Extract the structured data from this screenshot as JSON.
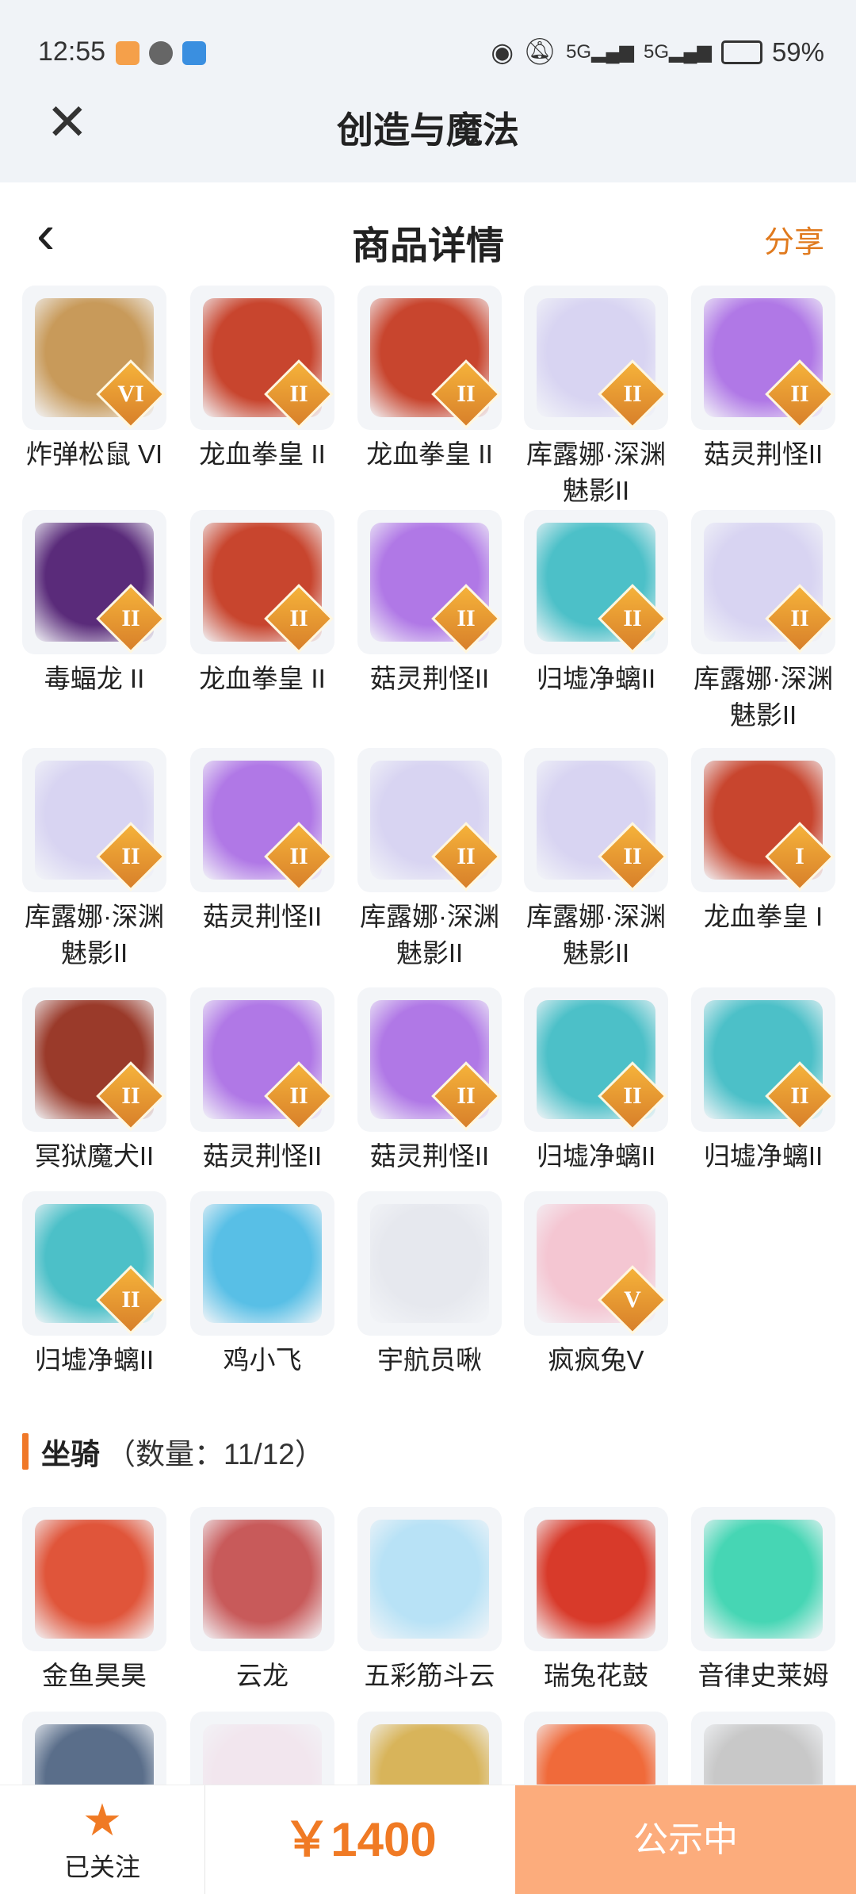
{
  "status_bar": {
    "time": "12:55",
    "battery": "59%",
    "icons": [
      "eye-icon",
      "bell-muted-icon",
      "signal-5g-icon",
      "signal-5g-icon",
      "battery-icon"
    ]
  },
  "app_bar": {
    "title": "创造与魔法",
    "close_icon": "close-icon"
  },
  "header": {
    "title": "商品详情",
    "share": "分享",
    "back_icon": "chevron-left-icon"
  },
  "pets": [
    {
      "name": "炸弹松鼠 VI",
      "badge": "VI",
      "color": "#c89a5a"
    },
    {
      "name": "龙血拳皇 II",
      "badge": "II",
      "color": "#c8452e"
    },
    {
      "name": "龙血拳皇 II",
      "badge": "II",
      "color": "#c8452e"
    },
    {
      "name": "库露娜·深渊魅影II",
      "badge": "II",
      "color": "#d8d4f2"
    },
    {
      "name": "菇灵荆怪II",
      "badge": "II",
      "color": "#b078e6"
    },
    {
      "name": "毒蝠龙 II",
      "badge": "II",
      "color": "#5a2b7a"
    },
    {
      "name": "龙血拳皇 II",
      "badge": "II",
      "color": "#c8452e"
    },
    {
      "name": "菇灵荆怪II",
      "badge": "II",
      "color": "#b078e6"
    },
    {
      "name": "归墟净螭II",
      "badge": "II",
      "color": "#4cc0c8"
    },
    {
      "name": "库露娜·深渊魅影II",
      "badge": "II",
      "color": "#d8d4f2"
    },
    {
      "name": "库露娜·深渊魅影II",
      "badge": "II",
      "color": "#d8d4f2"
    },
    {
      "name": "菇灵荆怪II",
      "badge": "II",
      "color": "#b078e6"
    },
    {
      "name": "库露娜·深渊魅影II",
      "badge": "II",
      "color": "#d8d4f2"
    },
    {
      "name": "库露娜·深渊魅影II",
      "badge": "II",
      "color": "#d8d4f2"
    },
    {
      "name": "龙血拳皇 I",
      "badge": "I",
      "color": "#c8452e"
    },
    {
      "name": "冥狱魔犬II",
      "badge": "II",
      "color": "#9a3a2a"
    },
    {
      "name": "菇灵荆怪II",
      "badge": "II",
      "color": "#b078e6"
    },
    {
      "name": "菇灵荆怪II",
      "badge": "II",
      "color": "#b078e6"
    },
    {
      "name": "归墟净螭II",
      "badge": "II",
      "color": "#4cc0c8"
    },
    {
      "name": "归墟净螭II",
      "badge": "II",
      "color": "#4cc0c8"
    },
    {
      "name": "归墟净螭II",
      "badge": "II",
      "color": "#4cc0c8"
    },
    {
      "name": "鸡小飞",
      "badge": "",
      "color": "#58bfe6"
    },
    {
      "name": "宇航员啾",
      "badge": "",
      "color": "#e6e8ee"
    },
    {
      "name": "疯疯兔V",
      "badge": "V",
      "color": "#f4c6d2"
    }
  ],
  "mounts_section": {
    "title": "坐骑",
    "count": "（数量：11/12）"
  },
  "mounts": [
    {
      "name": "金鱼昊昊",
      "color": "#e0553a"
    },
    {
      "name": "云龙",
      "color": "#c85a5a"
    },
    {
      "name": "五彩筋斗云",
      "color": "#b8e2f6"
    },
    {
      "name": "瑞兔花鼓",
      "color": "#d83a2a"
    },
    {
      "name": "音律史莱姆",
      "color": "#46d6b4"
    }
  ],
  "partial_row_colors": [
    "#5a6e8a",
    "#f2e6ee",
    "#d8b45a",
    "#f06a3a",
    "#c8c8c8"
  ],
  "bottom": {
    "fav_label": "已关注",
    "price": "￥1400",
    "action": "公示中"
  }
}
